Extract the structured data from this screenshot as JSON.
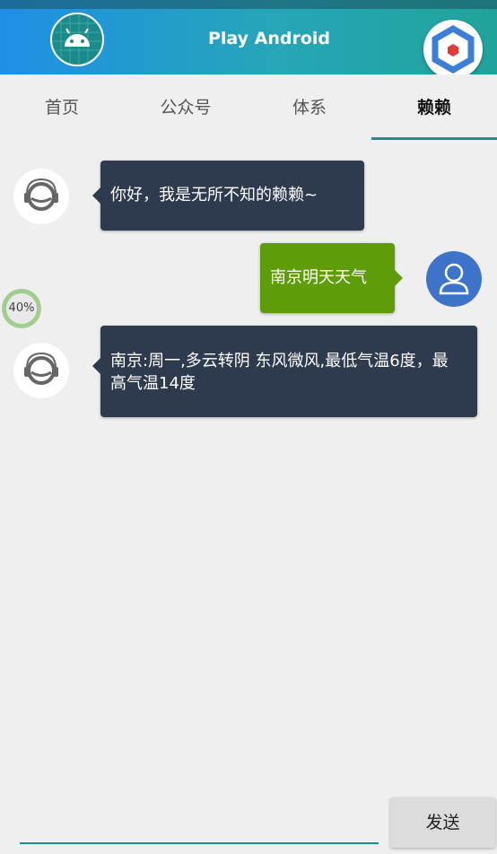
{
  "app": {
    "title": "Play Android"
  },
  "tabs": [
    {
      "label": "首页",
      "active": false
    },
    {
      "label": "公众号",
      "active": false
    },
    {
      "label": "体系",
      "active": false
    },
    {
      "label": "赖赖",
      "active": true
    }
  ],
  "chat": {
    "messages": [
      {
        "from": "bot",
        "text": "你好，我是无所不知的赖赖~"
      },
      {
        "from": "user",
        "text": "南京明天天气"
      },
      {
        "from": "bot",
        "text": "南京:周一,多云转阴 东风微风,最低气温6度，最高气温14度"
      }
    ]
  },
  "overlay": {
    "progress_text": "40%"
  },
  "input": {
    "send_label": "发送"
  },
  "colors": {
    "accent": "#1b8f8a",
    "bot_bubble": "#2e3b4e",
    "user_bubble": "#5e9c0a",
    "user_avatar": "#3d73c9"
  }
}
